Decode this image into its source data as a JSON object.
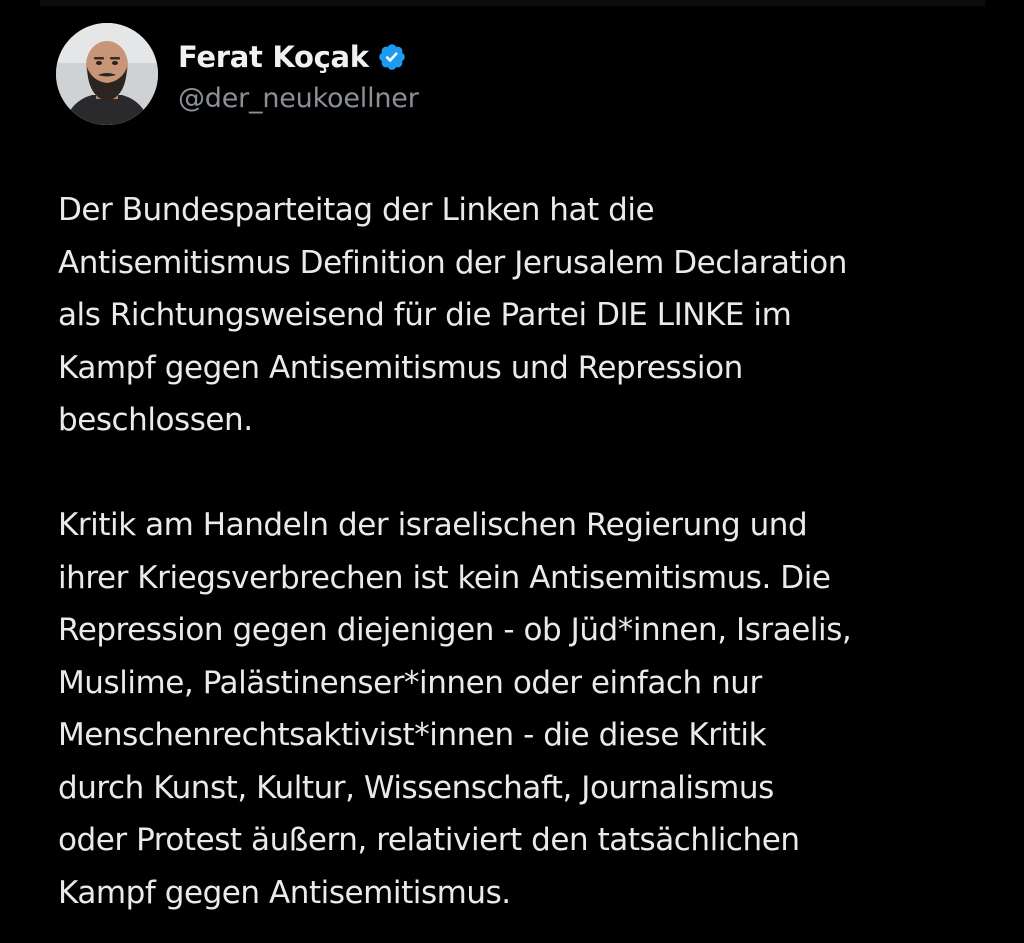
{
  "colors": {
    "background": "#000000",
    "text": "#e9eaeb",
    "handle": "#8b9096",
    "verified_badge": "#1d9bf0"
  },
  "author": {
    "display_name": "Ferat Koçak",
    "handle": "@der_neukoellner",
    "verified": true,
    "badge_icon": "verified-badge-icon",
    "avatar_icon": "profile-photo"
  },
  "post": {
    "paragraphs": [
      {
        "lines": [
          "Der Bundesparteitag der Linken hat die",
          "Antisemitismus Definition der Jerusalem Declaration",
          "als Richtungsweisend für die Partei DIE LINKE im",
          "Kampf gegen Antisemitismus und Repression",
          "beschlossen."
        ]
      },
      {
        "lines": [
          "Kritik am Handeln der israelischen Regierung und",
          "ihrer Kriegsverbrechen ist kein Antisemitismus. Die",
          "Repression gegen diejenigen - ob Jüd*innen, Israelis,",
          "Muslime, Palästinenser*innen oder einfach nur",
          "Menschenrechtsaktivist*innen - die diese Kritik",
          "durch Kunst, Kultur, Wissenschaft, Journalismus",
          "oder Protest äußern, relativiert den tatsächlichen",
          "Kampf gegen Antisemitismus."
        ]
      }
    ]
  }
}
